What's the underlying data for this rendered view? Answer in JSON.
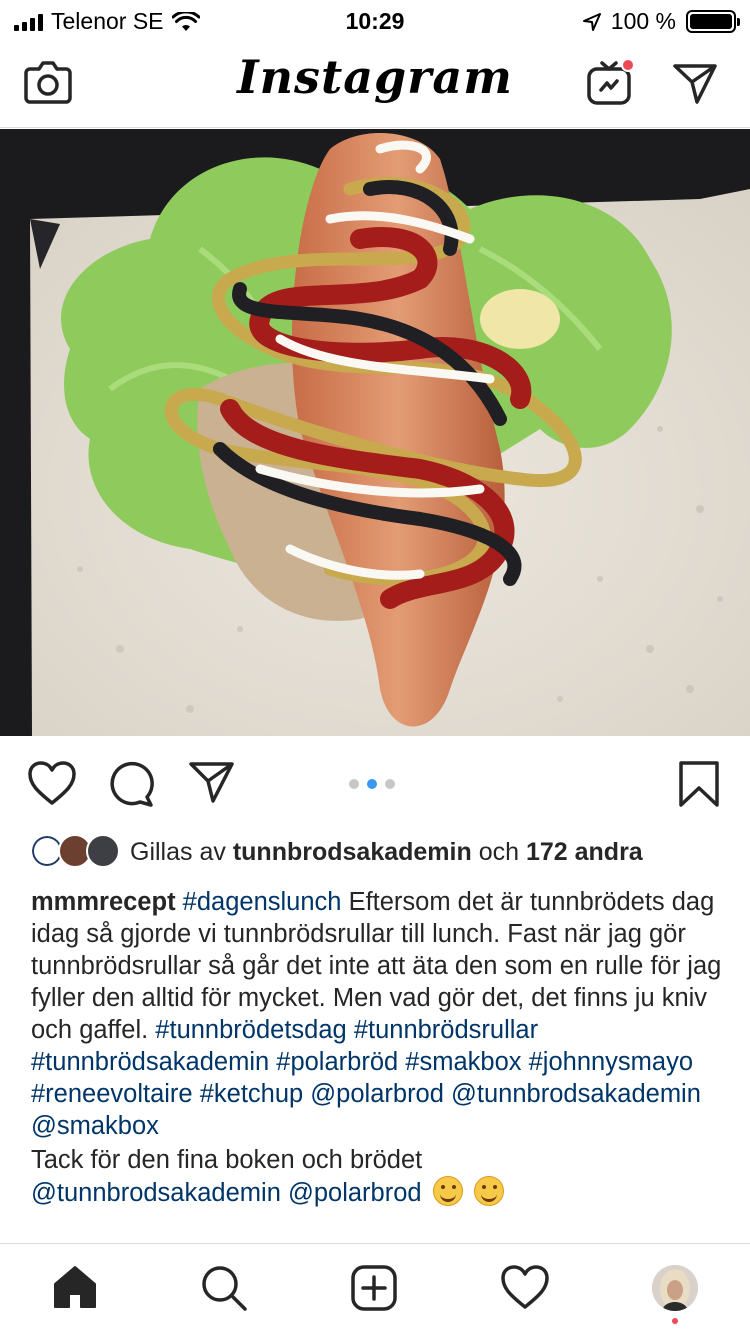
{
  "status_bar": {
    "carrier": "Telenor SE",
    "time": "10:29",
    "battery": "100 %"
  },
  "header": {
    "logo": "Instagram"
  },
  "post": {
    "carousel": {
      "count": 3,
      "active_index": 1
    },
    "likes": {
      "prefix": "Gillas av",
      "user": "tunnbrodsakademin",
      "joiner": "och",
      "others": "172 andra"
    },
    "caption": {
      "username": "mmmrecept",
      "hashtag_first": "#dagenslunch",
      "body": "Eftersom det är tunnbrödets dag idag så gjorde vi tunnbrödsrullar till lunch. Fast när jag gör tunnbrödsrullar så går det inte att äta den som en rulle för jag fyller den alltid för mycket. Men vad gör det, det finns ju kniv och gaffel.",
      "tags": [
        "#tunnbrödetsdag",
        "#tunnbrödsrullar",
        "#tunnbrödsakademin",
        "#polarbröd",
        "#smakbox",
        "#johnnysmayo",
        "#reneevoltaire",
        "#ketchup",
        "@polarbrod",
        "@tunnbrodsakademin",
        "@smakbox"
      ],
      "thanks_line": "Tack för den fina boken och brödet",
      "thanks_mentions": "@tunnbrodsakademin @polarbrod"
    }
  },
  "icons": {
    "header": [
      "camera-icon",
      "igtv-icon",
      "direct-message-icon"
    ],
    "actions": [
      "heart-icon",
      "comment-icon",
      "share-icon",
      "bookmark-icon"
    ],
    "nav": [
      "home-icon",
      "search-icon",
      "new-post-icon",
      "activity-icon",
      "profile-avatar"
    ]
  },
  "colors": {
    "link": "#003569",
    "active_dot": "#3897f0",
    "notification": "#ed4956"
  }
}
